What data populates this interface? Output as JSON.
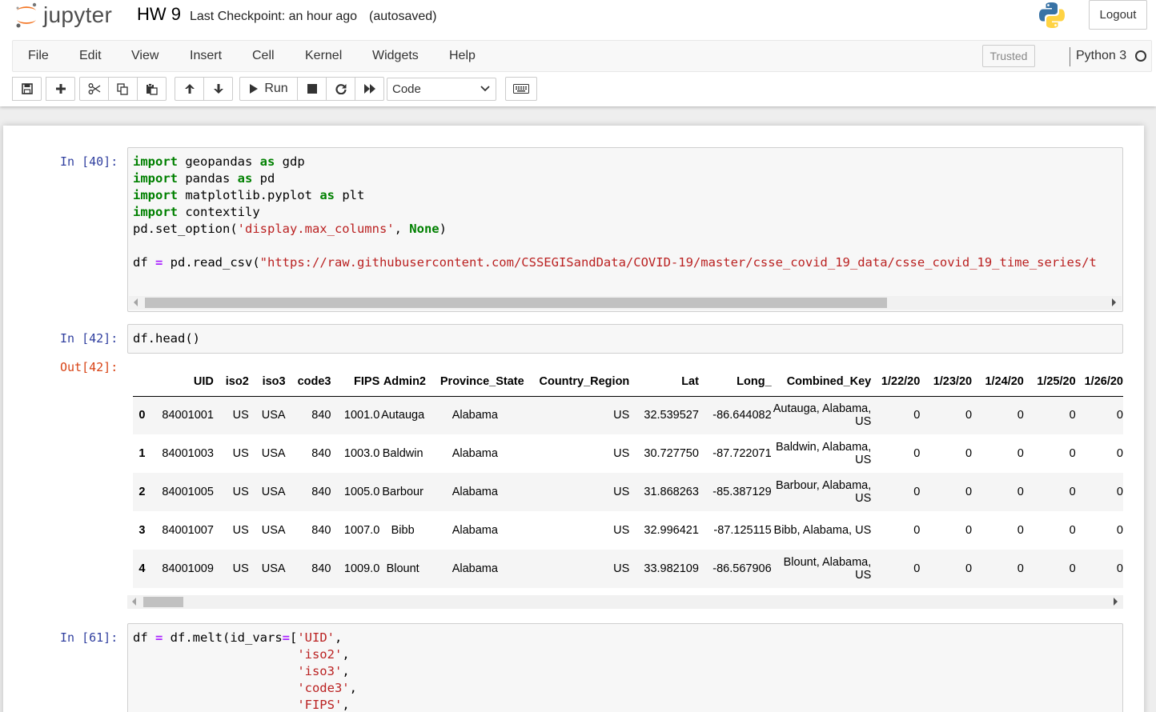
{
  "header": {
    "logo_text": "jupyter",
    "notebook_name": "HW 9",
    "checkpoint": "Last Checkpoint: an hour ago",
    "autosave": "(autosaved)",
    "logout_label": "Logout"
  },
  "menubar": {
    "items": [
      "File",
      "Edit",
      "View",
      "Insert",
      "Cell",
      "Kernel",
      "Widgets",
      "Help"
    ],
    "trusted": "Trusted",
    "kernel": "Python 3"
  },
  "toolbar": {
    "run_label": "Run",
    "cell_type": "Code"
  },
  "cells": [
    {
      "prompt": "In [40]:",
      "code_lines": [
        "import geopandas as gdp",
        "import pandas as pd",
        "import matplotlib.pyplot as plt",
        "import contextily",
        "pd.set_option('display.max_columns', None)",
        "",
        "df = pd.read_csv(\"https://raw.githubusercontent.com/CSSEGISandData/COVID-19/master/csse_covid_19_data/csse_covid_19_time_series/t"
      ]
    },
    {
      "prompt": "In [42]:",
      "code_lines": [
        "df.head()"
      ],
      "out_prompt": "Out[42]:"
    },
    {
      "prompt": "In [61]:",
      "code_lines": [
        "df = df.melt(id_vars=['UID',",
        "                      'iso2',",
        "                      'iso3',",
        "                      'code3',",
        "                      'FIPS',"
      ]
    }
  ],
  "dataframe": {
    "columns": [
      "",
      "UID",
      "iso2",
      "iso3",
      "code3",
      "FIPS",
      "Admin2",
      "Province_State",
      "Country_Region",
      "Lat",
      "Long_",
      "Combined_Key",
      "1/22/20",
      "1/23/20",
      "1/24/20",
      "1/25/20",
      "1/26/20"
    ],
    "rows": [
      [
        "0",
        "84001001",
        "US",
        "USA",
        "840",
        "1001.0",
        "Autauga",
        "Alabama",
        "US",
        "32.539527",
        "-86.644082",
        "Autauga, Alabama, US",
        "0",
        "0",
        "0",
        "0",
        "0"
      ],
      [
        "1",
        "84001003",
        "US",
        "USA",
        "840",
        "1003.0",
        "Baldwin",
        "Alabama",
        "US",
        "30.727750",
        "-87.722071",
        "Baldwin, Alabama, US",
        "0",
        "0",
        "0",
        "0",
        "0"
      ],
      [
        "2",
        "84001005",
        "US",
        "USA",
        "840",
        "1005.0",
        "Barbour",
        "Alabama",
        "US",
        "31.868263",
        "-85.387129",
        "Barbour, Alabama, US",
        "0",
        "0",
        "0",
        "0",
        "0"
      ],
      [
        "3",
        "84001007",
        "US",
        "USA",
        "840",
        "1007.0",
        "Bibb",
        "Alabama",
        "US",
        "32.996421",
        "-87.125115",
        "Bibb, Alabama, US",
        "0",
        "0",
        "0",
        "0",
        "0"
      ],
      [
        "4",
        "84001009",
        "US",
        "USA",
        "840",
        "1009.0",
        "Blount",
        "Alabama",
        "US",
        "33.982109",
        "-86.567906",
        "Blount, Alabama, US",
        "0",
        "0",
        "0",
        "0",
        "0"
      ]
    ]
  },
  "colors": {
    "in_prompt": "#303f9f",
    "out_prompt": "#d84315",
    "keyword": "#008000",
    "string": "#ba2121",
    "operator": "#aa22ff"
  }
}
